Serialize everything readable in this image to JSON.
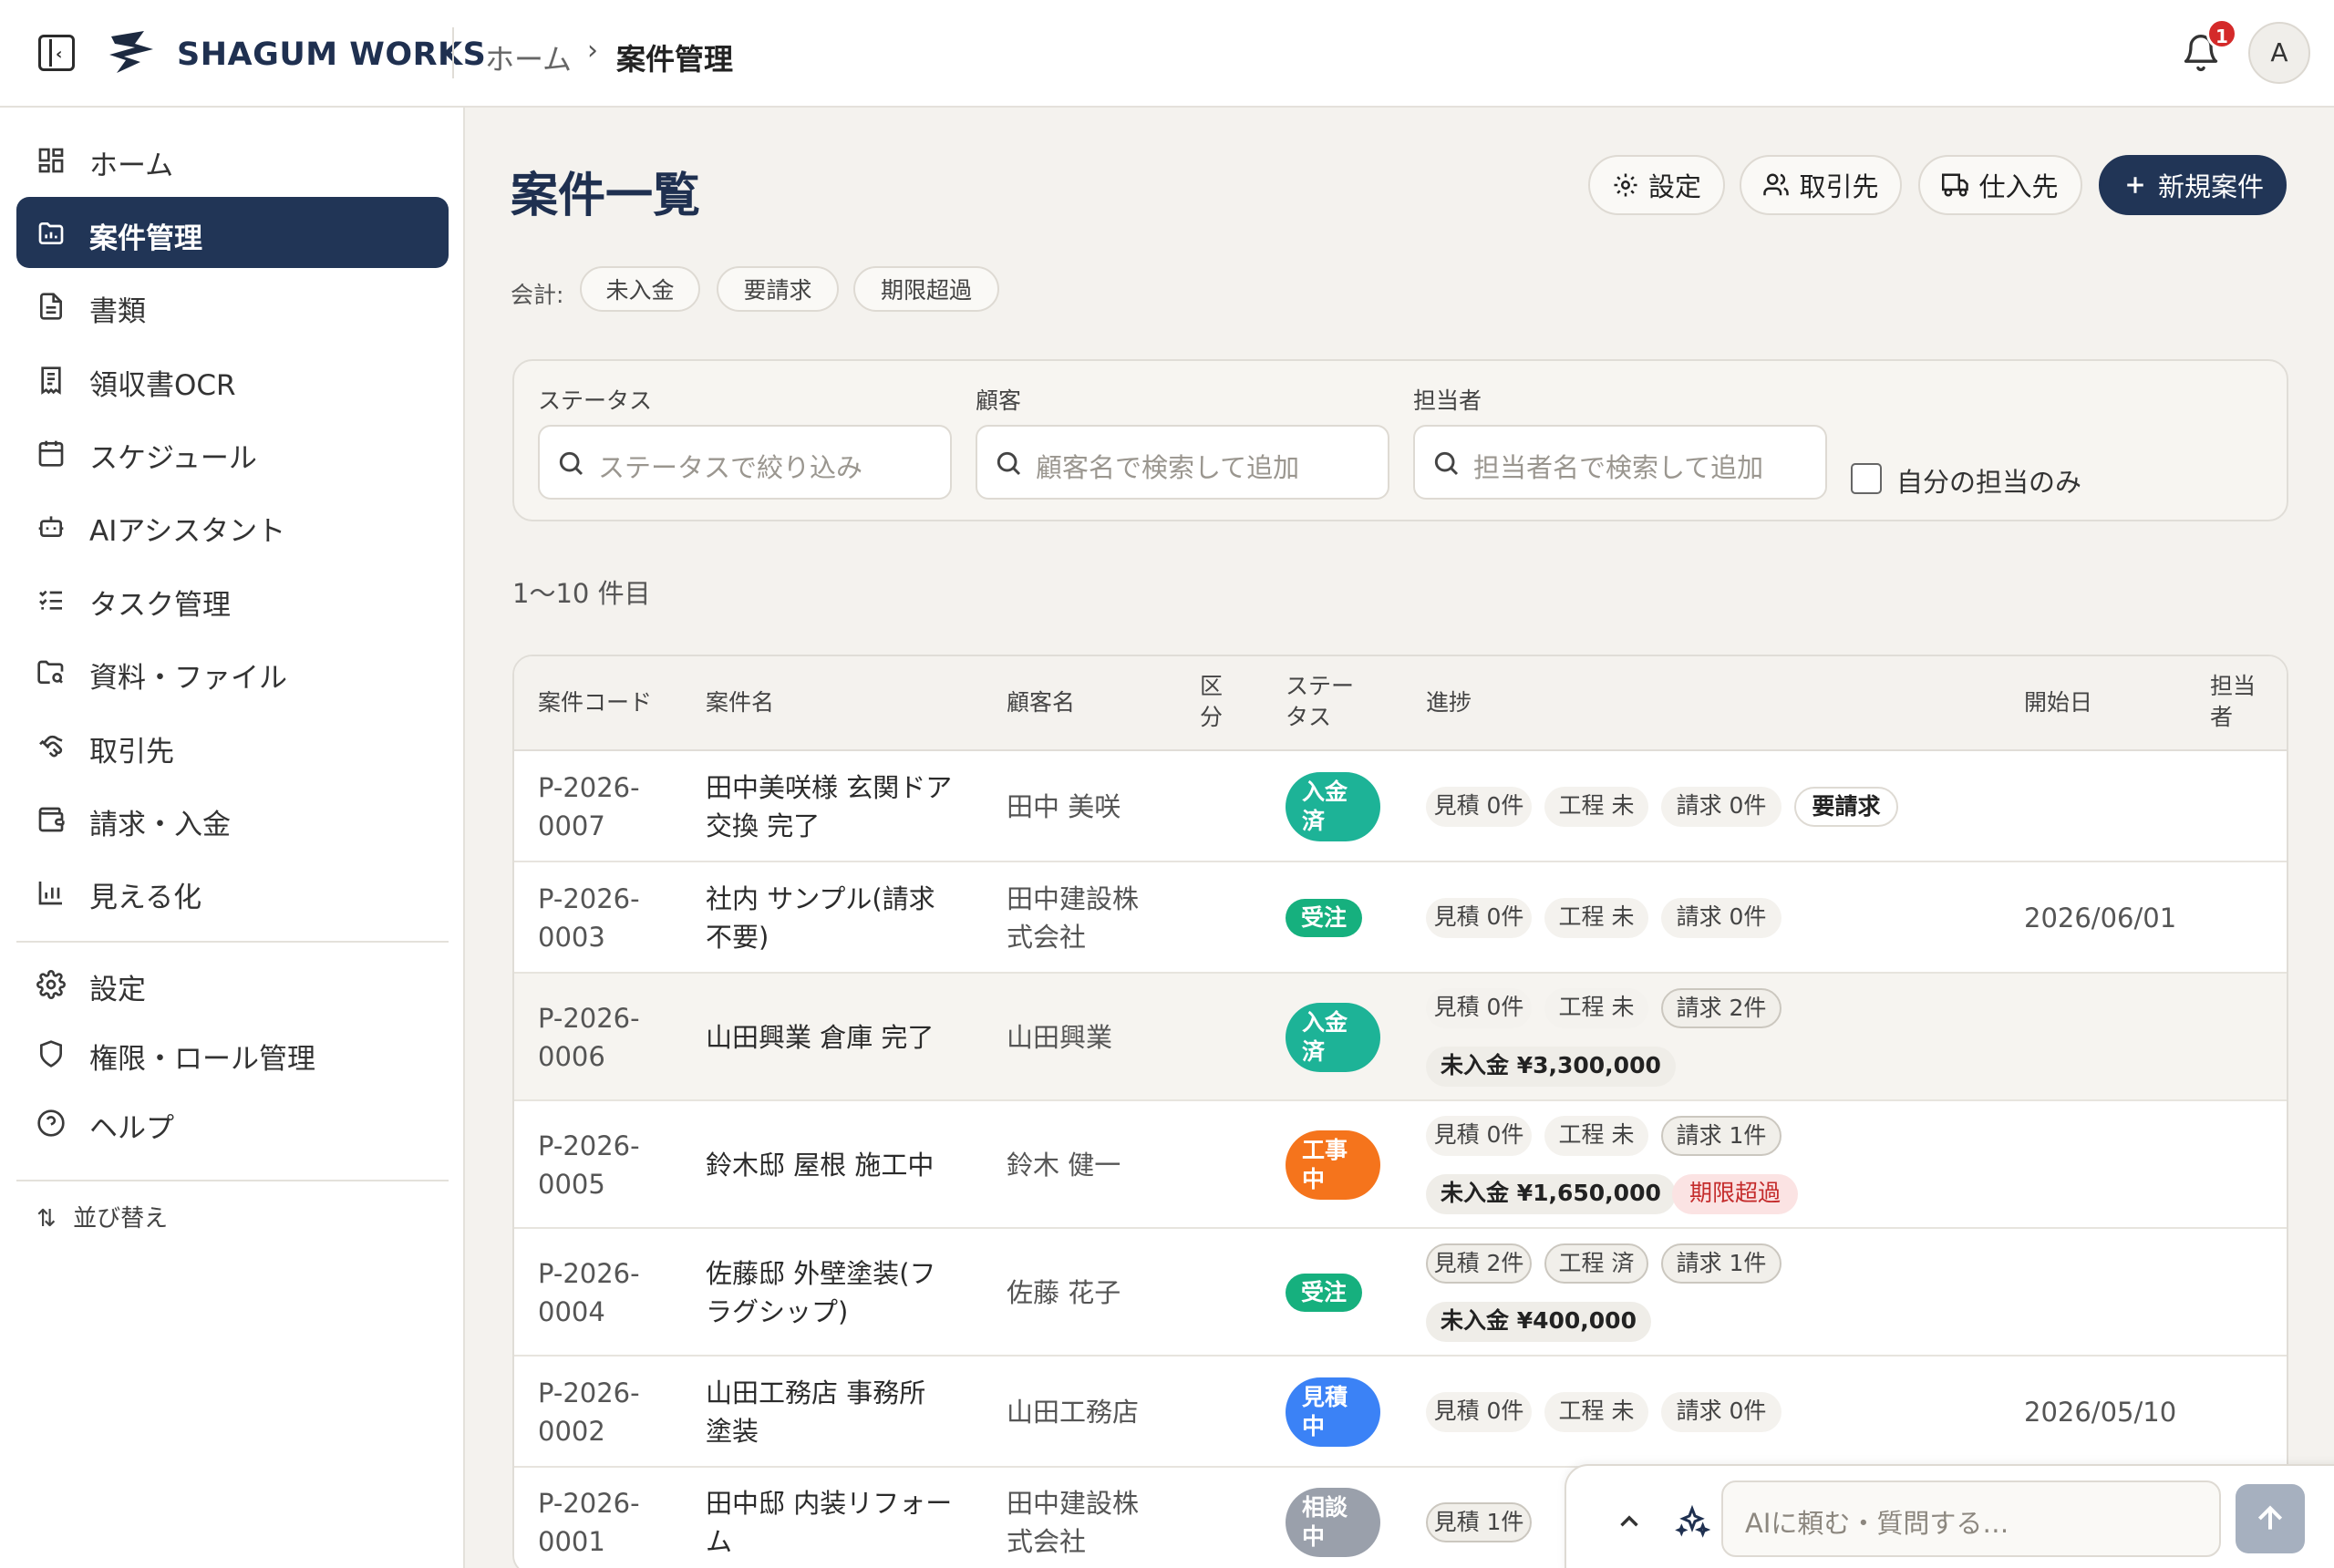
{
  "header": {
    "brand": "SHAGUM WORKS",
    "breadcrumb": [
      "ホーム",
      "案件管理"
    ],
    "notification_count": "1",
    "avatar_initial": "A"
  },
  "sidebar": {
    "items": [
      {
        "label": "ホーム",
        "icon": "grid-icon"
      },
      {
        "label": "案件管理",
        "icon": "folder-chart-icon",
        "active": true
      },
      {
        "label": "書類",
        "icon": "document-icon"
      },
      {
        "label": "領収書OCR",
        "icon": "receipt-icon"
      },
      {
        "label": "スケジュール",
        "icon": "calendar-icon"
      },
      {
        "label": "AIアシスタント",
        "icon": "robot-icon"
      },
      {
        "label": "タスク管理",
        "icon": "checklist-icon"
      },
      {
        "label": "資料・ファイル",
        "icon": "folder-search-icon"
      },
      {
        "label": "取引先",
        "icon": "handshake-icon"
      },
      {
        "label": "請求・入金",
        "icon": "wallet-icon"
      },
      {
        "label": "見える化",
        "icon": "bar-chart-icon"
      }
    ],
    "settings_items": [
      {
        "label": "設定",
        "icon": "gear-icon"
      },
      {
        "label": "権限・ロール管理",
        "icon": "shield-icon"
      },
      {
        "label": "ヘルプ",
        "icon": "help-circle-icon"
      }
    ],
    "sort_label": "並び替え"
  },
  "main": {
    "title": "案件一覧",
    "buttons": {
      "settings": "設定",
      "clients": "取引先",
      "suppliers": "仕入先",
      "new_project": "新規案件"
    },
    "accounting_label": "会計:",
    "accounting_chips": [
      "未入金",
      "要請求",
      "期限超過"
    ],
    "filters": {
      "status_label": "ステータス",
      "status_placeholder": "ステータスで絞り込み",
      "customer_label": "顧客",
      "customer_placeholder": "顧客名で検索して追加",
      "assignee_label": "担当者",
      "assignee_placeholder": "担当者名で検索して追加",
      "mine_only_label": "自分の担当のみ"
    },
    "range_text": "1〜10 件目"
  },
  "table": {
    "headers": {
      "code": "案件コード",
      "name": "案件名",
      "customer": "顧客名",
      "category": "区\n分",
      "status": "ステー\nタス",
      "progress": "進捗",
      "start_date": "開始日",
      "assignee": "担当\n者"
    },
    "rows": [
      {
        "code": "P-2026-\n0007",
        "name": "田中美咲様 玄関ドア\n交換 完了",
        "customer": "田中 美咲",
        "status": "入金\n済",
        "status_color": "#1db397",
        "est": "見積 0件",
        "work": "工程 未",
        "bill": "請求 0件",
        "tags": [
          "要請求"
        ],
        "money": "",
        "overdue": "",
        "start": ""
      },
      {
        "code": "P-2026-\n0003",
        "name": "社内 サンプル(請求\n不要)",
        "customer": "田中建設株\n式会社",
        "status": "受注",
        "status_color": "#16b07e",
        "est": "見積 0件",
        "work": "工程 未",
        "bill": "請求 0件",
        "tags": [],
        "money": "",
        "overdue": "",
        "start": "2026/06/01"
      },
      {
        "code": "P-2026-\n0006",
        "name": "山田興業 倉庫 完了",
        "customer": "山田興業",
        "status": "入金\n済",
        "status_color": "#1db397",
        "est": "見積 0件",
        "work": "工程 未",
        "bill": "請求 2件",
        "tags": [],
        "money": "未入金 ¥3,300,000",
        "overdue": "",
        "start": ""
      },
      {
        "code": "P-2026-\n0005",
        "name": "鈴木邸 屋根 施工中",
        "customer": "鈴木 健一",
        "status": "工事\n中",
        "status_color": "#f5741c",
        "est": "見積 0件",
        "work": "工程 未",
        "bill": "請求 1件",
        "tags": [],
        "money": "未入金 ¥1,650,000",
        "overdue": "期限超過",
        "start": ""
      },
      {
        "code": "P-2026-\n0004",
        "name": "佐藤邸 外壁塗装(フ\nラグシップ)",
        "customer": "佐藤 花子",
        "status": "受注",
        "status_color": "#16b07e",
        "est": "見積 2件",
        "work": "工程 済",
        "bill": "請求 1件",
        "tags": [],
        "money": "未入金 ¥400,000",
        "overdue": "",
        "start": ""
      },
      {
        "code": "P-2026-\n0002",
        "name": "山田工務店 事務所\n塗装",
        "customer": "山田工務店",
        "status": "見積\n中",
        "status_color": "#3b82f6",
        "est": "見積 0件",
        "work": "工程 未",
        "bill": "請求 0件",
        "tags": [],
        "money": "",
        "overdue": "",
        "start": "2026/05/10"
      },
      {
        "code": "P-2026-\n0001",
        "name": "田中邸 内装リフォー\nム",
        "customer": "田中建設株\n式会社",
        "status": "相談\n中",
        "status_color": "#9aa0ab",
        "est": "見積 1件",
        "work": "",
        "bill": "",
        "tags": [],
        "money": "",
        "overdue": "",
        "start": ""
      }
    ]
  },
  "ai_bar": {
    "placeholder": "AIに頼む・質問する…"
  },
  "colors": {
    "navy": "#213556",
    "background": "#f4f2ee",
    "overdue_text": "#c42b2b"
  }
}
